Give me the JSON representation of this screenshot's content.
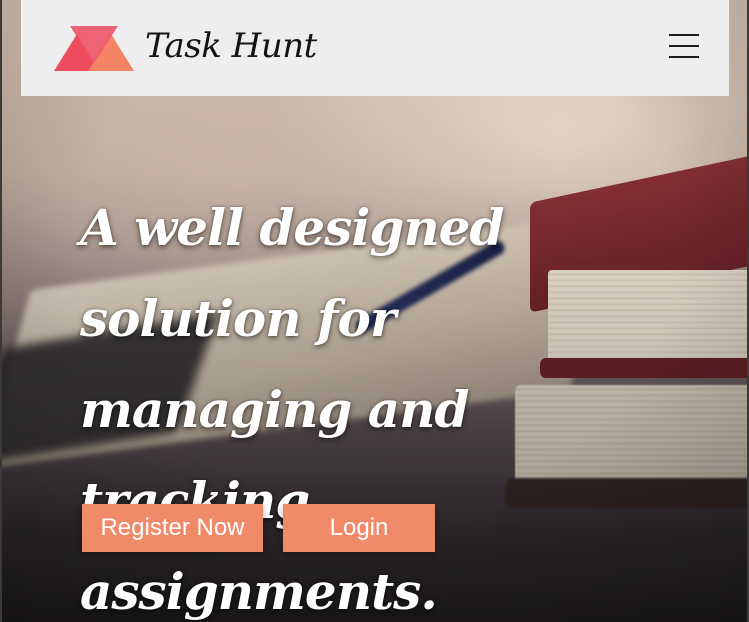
{
  "header": {
    "brand_name": "Task Hunt",
    "logo_icon": "triangles-logo-icon",
    "menu_icon": "hamburger-menu-icon"
  },
  "hero": {
    "headline": "A well designed solution for managing and tracking assignments.",
    "register_label": "Register Now",
    "login_label": "Login"
  },
  "colors": {
    "accent": "#f08a68",
    "logo_red": "#ee4c5e",
    "logo_orange": "#f48465",
    "header_bg": "#eeeeee"
  }
}
